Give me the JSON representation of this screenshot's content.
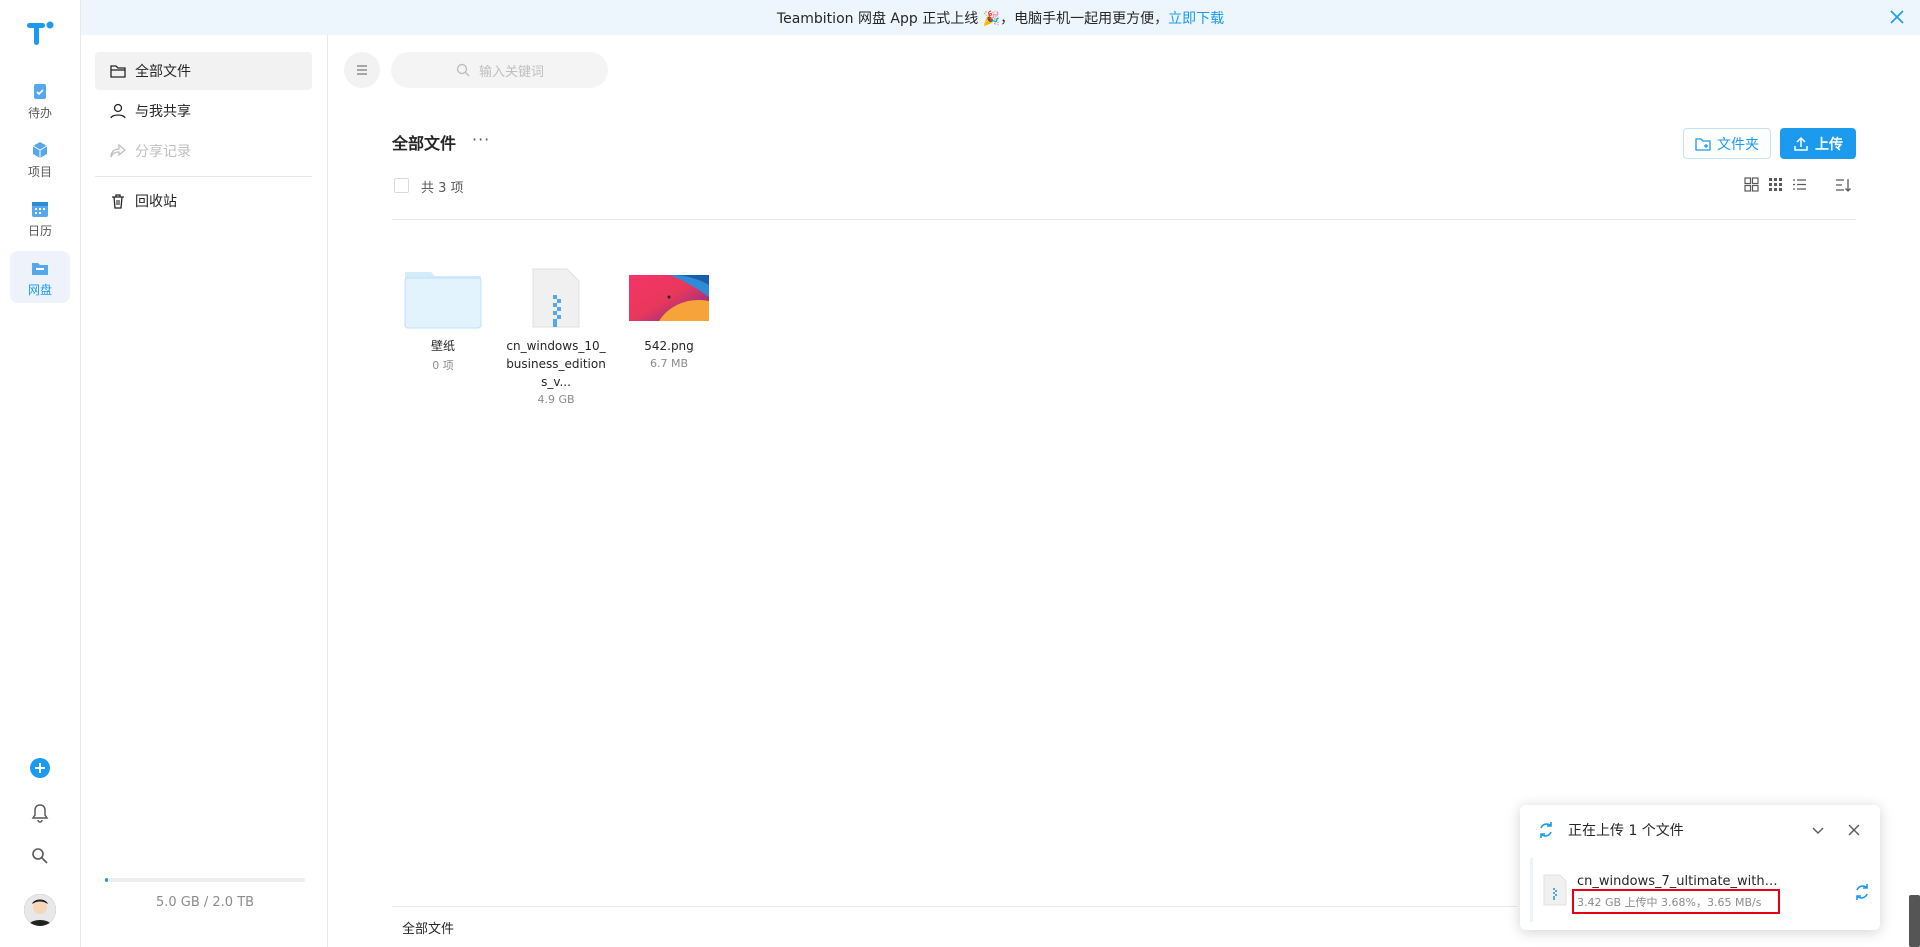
{
  "rail": {
    "items": [
      {
        "label": "待办",
        "icon": "clipboard-icon"
      },
      {
        "label": "项目",
        "icon": "cube-icon"
      },
      {
        "label": "日历",
        "icon": "calendar-icon"
      },
      {
        "label": "网盘",
        "icon": "folder-drive-icon"
      }
    ]
  },
  "banner": {
    "text": "Teambition 网盘 App 正式上线 🎉，电脑手机一起用更方便，",
    "link": "立即下载"
  },
  "nav": {
    "items": [
      {
        "label": "全部文件"
      },
      {
        "label": "与我共享"
      },
      {
        "label": "分享记录"
      },
      {
        "label": "回收站"
      }
    ],
    "storage": "5.0 GB / 2.0 TB",
    "storage_used_fraction": 0.0025
  },
  "search": {
    "placeholder": "输入关键词"
  },
  "main": {
    "title": "全部文件",
    "more": "···",
    "btn_folder": "文件夹",
    "btn_upload": "上传",
    "count": "共 3 项",
    "files": [
      {
        "name": "壁纸",
        "meta": "0 项",
        "type": "folder"
      },
      {
        "name": "cn_windows_10_business_editions_v...",
        "meta": "4.9 GB",
        "type": "zip"
      },
      {
        "name": "542.png",
        "meta": "6.7 MB",
        "type": "image"
      }
    ],
    "footer": "全部文件"
  },
  "upload": {
    "title": "正在上传 1 个文件",
    "file_name": "cn_windows_7_ultimate_with_s...",
    "status": "3.42 GB 上传中 3.68%，3.65 MB/s",
    "progress_percent": 3.68
  },
  "colors": {
    "accent": "#1b9aee",
    "highlight": "#e60012"
  }
}
